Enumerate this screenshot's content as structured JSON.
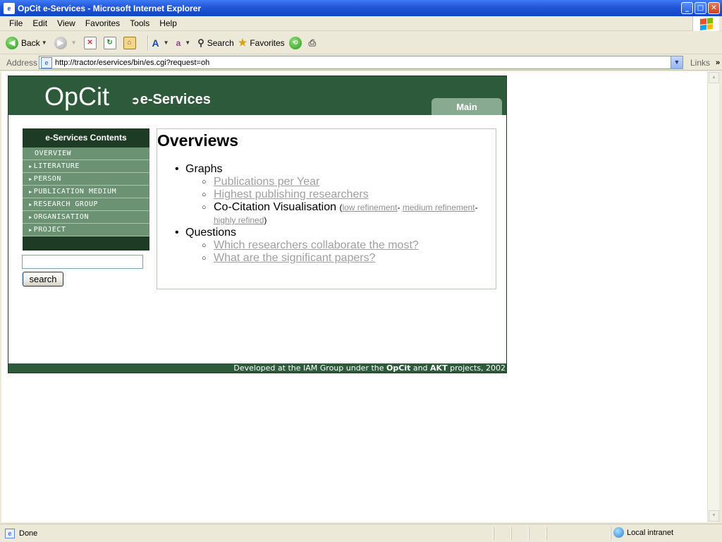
{
  "window": {
    "title": "OpCit e-Services - Microsoft Internet Explorer",
    "min_glyph": "_",
    "max_glyph": "□",
    "close_glyph": "✕"
  },
  "menu": [
    "File",
    "Edit",
    "View",
    "Favorites",
    "Tools",
    "Help"
  ],
  "toolbar": {
    "back_label": "Back",
    "search_label": "Search",
    "favorites_label": "Favorites"
  },
  "address": {
    "label": "Address",
    "url": "http://tractor/eservices/bin/es.cgi?request=oh",
    "links_label": "Links"
  },
  "page": {
    "logo": "OpCit",
    "subtitle": "e-Services",
    "main_tab": "Main",
    "sidebar": {
      "heading": "e-Services Contents",
      "items": [
        {
          "label": "Overview",
          "active": true
        },
        {
          "label": "Literature",
          "active": false
        },
        {
          "label": "Person",
          "active": false
        },
        {
          "label": "Publication Medium",
          "active": false
        },
        {
          "label": "Research Group",
          "active": false
        },
        {
          "label": "Organisation",
          "active": false
        },
        {
          "label": "Project",
          "active": false
        }
      ],
      "search_value": "",
      "search_button": "search"
    },
    "content": {
      "heading": "Overviews",
      "graphs_label": "Graphs",
      "graphs": {
        "pubs_per_year": "Publications per Year",
        "highest_researchers": "Highest publishing researchers",
        "cocitation_label": "Co-Citation Visualisation",
        "open_paren": "(",
        "low_refinement": "low refinement",
        "dash1": "- ",
        "medium_refinement": "medium refinement",
        "dash2": "-",
        "highly_refined": "highly refined",
        "close_paren": ")"
      },
      "questions_label": "Questions",
      "questions": {
        "collaborate": "Which researchers collaborate the most?",
        "significant": "What are the significant papers?"
      }
    },
    "footer": {
      "prefix": "Developed at the IAM Group under the ",
      "opcit": "OpCit",
      "and": " and ",
      "akt": "AKT",
      "suffix": " projects, 2002"
    }
  },
  "status": {
    "text": "Done",
    "zone": "Local intranet"
  }
}
